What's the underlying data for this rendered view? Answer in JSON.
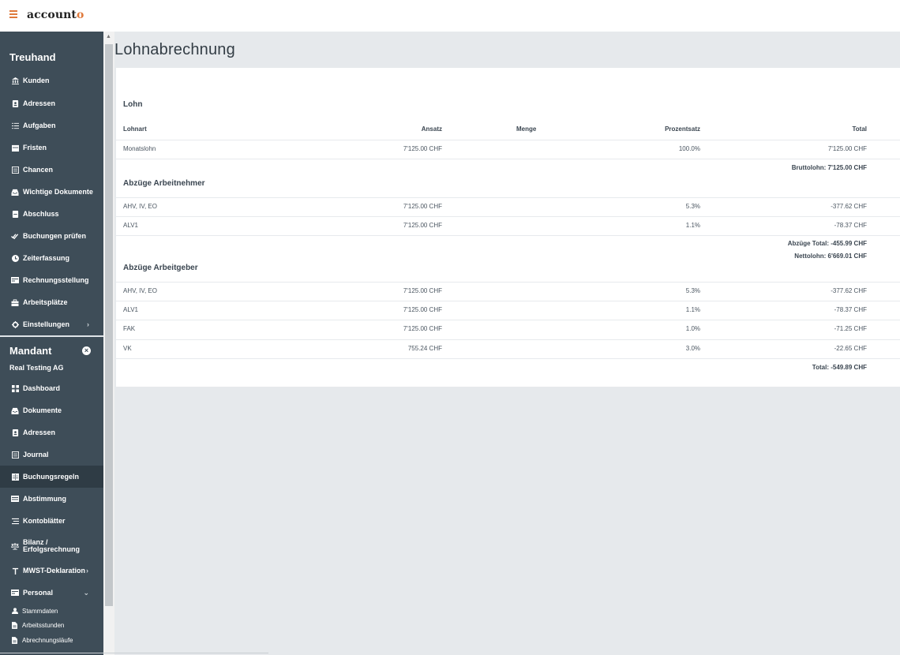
{
  "app": {
    "logo_text": "account",
    "logo_accent": "o"
  },
  "sidebar": {
    "treuhand_heading": "Treuhand",
    "treuhand_items": [
      {
        "label": "Kunden",
        "icon": "bank-icon"
      },
      {
        "label": "Adressen",
        "icon": "address-book-icon"
      },
      {
        "label": "Aufgaben",
        "icon": "task-list-icon"
      },
      {
        "label": "Fristen",
        "icon": "calendar-icon"
      },
      {
        "label": "Chancen",
        "icon": "list-box-icon"
      },
      {
        "label": "Wichtige Dokumente",
        "icon": "inbox-icon"
      },
      {
        "label": "Abschluss",
        "icon": "archive-icon"
      },
      {
        "label": "Buchungen prüfen",
        "icon": "check-double-icon"
      },
      {
        "label": "Zeiterfassung",
        "icon": "clock-icon"
      },
      {
        "label": "Rechnungsstellung",
        "icon": "invoice-icon"
      },
      {
        "label": "Arbeitsplätze",
        "icon": "briefcase-icon"
      },
      {
        "label": "Einstellungen",
        "icon": "gear-icon"
      }
    ],
    "mandant_heading": "Mandant",
    "mandant_name": "Real Testing AG",
    "mandant_items": [
      {
        "label": "Dashboard",
        "icon": "dashboard-icon"
      },
      {
        "label": "Dokumente",
        "icon": "inbox-icon"
      },
      {
        "label": "Adressen",
        "icon": "address-book-icon"
      },
      {
        "label": "Journal",
        "icon": "journal-icon"
      },
      {
        "label": "Buchungsregeln",
        "icon": "rules-table-icon",
        "active": true
      },
      {
        "label": "Abstimmung",
        "icon": "reconcile-icon"
      },
      {
        "label": "Kontoblätter",
        "icon": "ledger-icon"
      },
      {
        "label": "Bilanz / Erfolgsrechnung",
        "icon": "balance-scale-icon"
      },
      {
        "label": "MWST-Deklaration",
        "icon": "tax-icon"
      },
      {
        "label": "Personal",
        "icon": "personnel-icon"
      }
    ],
    "personal_subitems": [
      {
        "label": "Stammdaten",
        "icon": "user-icon"
      },
      {
        "label": "Arbeitsstunden",
        "icon": "document-icon"
      },
      {
        "label": "Abrechnungsläufe",
        "icon": "document-icon"
      }
    ],
    "colors": {
      "background": "#3e4d58",
      "active": "#2f3c45",
      "accent": "#e07a3c"
    }
  },
  "page": {
    "title": "Lohnabrechnung"
  },
  "columns": {
    "lohnart": "Lohnart",
    "ansatz": "Ansatz",
    "menge": "Menge",
    "prozentsatz": "Prozentsatz",
    "total": "Total"
  },
  "lohn": {
    "title": "Lohn",
    "rows": [
      {
        "lohnart": "Monatslohn",
        "ansatz": "7'125.00 CHF",
        "menge": "",
        "prozentsatz": "100.0%",
        "total": "7'125.00 CHF"
      }
    ],
    "summary": "Bruttolohn: 7'125.00 CHF"
  },
  "arbeitnehmer": {
    "title": "Abzüge Arbeitnehmer",
    "rows": [
      {
        "lohnart": "AHV, IV, EO",
        "ansatz": "7'125.00 CHF",
        "prozentsatz": "5.3%",
        "total": "-377.62 CHF"
      },
      {
        "lohnart": "ALV1",
        "ansatz": "7'125.00 CHF",
        "prozentsatz": "1.1%",
        "total": "-78.37 CHF"
      }
    ],
    "summary_total": "Abzüge Total: -455.99 CHF",
    "summary_netto": "Nettolohn: 6'669.01 CHF"
  },
  "arbeitgeber": {
    "title": "Abzüge Arbeitgeber",
    "rows": [
      {
        "lohnart": "AHV, IV, EO",
        "ansatz": "7'125.00 CHF",
        "prozentsatz": "5.3%",
        "total": "-377.62 CHF"
      },
      {
        "lohnart": "ALV1",
        "ansatz": "7'125.00 CHF",
        "prozentsatz": "1.1%",
        "total": "-78.37 CHF"
      },
      {
        "lohnart": "FAK",
        "ansatz": "7'125.00 CHF",
        "prozentsatz": "1.0%",
        "total": "-71.25 CHF"
      },
      {
        "lohnart": "VK",
        "ansatz": "755.24 CHF",
        "prozentsatz": "3.0%",
        "total": "-22.65 CHF"
      }
    ],
    "summary": "Total: -549.89 CHF"
  }
}
